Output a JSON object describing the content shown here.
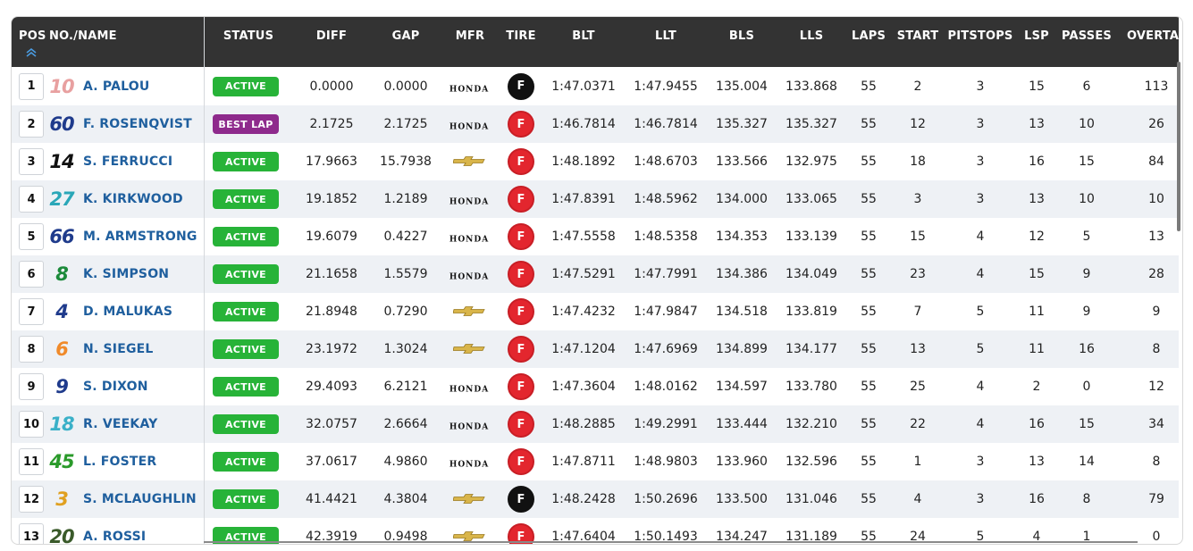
{
  "columns": {
    "pos": "POS",
    "name": "NO./NAME",
    "status": "STATUS",
    "diff": "DIFF",
    "gap": "GAP",
    "mfr": "MFR",
    "tire": "TIRE",
    "blt": "BLT",
    "llt": "LLT",
    "bls": "BLS",
    "lls": "LLS",
    "laps": "LAPS",
    "start": "START",
    "pitstops": "PITSTOPS",
    "lsp": "LSP",
    "passes": "PASSES",
    "overtakes": "OVERTAKE"
  },
  "colors": {
    "active": "#27b338",
    "best_lap": "#8e2a8c",
    "tire_red": "#e3262e",
    "tire_black": "#111111",
    "name_blue": "#1f5f9e",
    "header_bg": "#333333"
  },
  "rows": [
    {
      "pos": "1",
      "num": "10",
      "num_color": "#e8a0a0",
      "name": "A. PALOU",
      "status": "ACTIVE",
      "diff": "0.0000",
      "gap": "0.0000",
      "mfr": "HONDA",
      "tire": "black",
      "blt": "1:47.0371",
      "llt": "1:47.9455",
      "bls": "135.004",
      "lls": "133.868",
      "laps": "55",
      "start": "2",
      "pitstops": "3",
      "lsp": "15",
      "passes": "6",
      "overtakes": "113"
    },
    {
      "pos": "2",
      "num": "60",
      "num_color": "#1f3b8c",
      "name": "F. ROSENQVIST",
      "status": "BEST LAP",
      "diff": "2.1725",
      "gap": "2.1725",
      "mfr": "HONDA",
      "tire": "red",
      "blt": "1:46.7814",
      "llt": "1:46.7814",
      "bls": "135.327",
      "lls": "135.327",
      "laps": "55",
      "start": "12",
      "pitstops": "3",
      "lsp": "13",
      "passes": "10",
      "overtakes": "26"
    },
    {
      "pos": "3",
      "num": "14",
      "num_color": "#111111",
      "name": "S. FERRUCCI",
      "status": "ACTIVE",
      "diff": "17.9663",
      "gap": "15.7938",
      "mfr": "CHEVROLET",
      "tire": "red",
      "blt": "1:48.1892",
      "llt": "1:48.6703",
      "bls": "133.566",
      "lls": "132.975",
      "laps": "55",
      "start": "18",
      "pitstops": "3",
      "lsp": "16",
      "passes": "15",
      "overtakes": "84"
    },
    {
      "pos": "4",
      "num": "27",
      "num_color": "#2aa7b8",
      "name": "K. KIRKWOOD",
      "status": "ACTIVE",
      "diff": "19.1852",
      "gap": "1.2189",
      "mfr": "HONDA",
      "tire": "red",
      "blt": "1:47.8391",
      "llt": "1:48.5962",
      "bls": "134.000",
      "lls": "133.065",
      "laps": "55",
      "start": "3",
      "pitstops": "3",
      "lsp": "13",
      "passes": "10",
      "overtakes": "10"
    },
    {
      "pos": "5",
      "num": "66",
      "num_color": "#1f3b8c",
      "name": "M. ARMSTRONG",
      "status": "ACTIVE",
      "diff": "19.6079",
      "gap": "0.4227",
      "mfr": "HONDA",
      "tire": "red",
      "blt": "1:47.5558",
      "llt": "1:48.5358",
      "bls": "134.353",
      "lls": "133.139",
      "laps": "55",
      "start": "15",
      "pitstops": "4",
      "lsp": "12",
      "passes": "5",
      "overtakes": "13"
    },
    {
      "pos": "6",
      "num": "8",
      "num_color": "#1b8a3a",
      "name": "K. SIMPSON",
      "status": "ACTIVE",
      "diff": "21.1658",
      "gap": "1.5579",
      "mfr": "HONDA",
      "tire": "red",
      "blt": "1:47.5291",
      "llt": "1:47.7991",
      "bls": "134.386",
      "lls": "134.049",
      "laps": "55",
      "start": "23",
      "pitstops": "4",
      "lsp": "15",
      "passes": "9",
      "overtakes": "28"
    },
    {
      "pos": "7",
      "num": "4",
      "num_color": "#1f3b8c",
      "name": "D. MALUKAS",
      "status": "ACTIVE",
      "diff": "21.8948",
      "gap": "0.7290",
      "mfr": "CHEVROLET",
      "tire": "red",
      "blt": "1:47.4232",
      "llt": "1:47.9847",
      "bls": "134.518",
      "lls": "133.819",
      "laps": "55",
      "start": "7",
      "pitstops": "5",
      "lsp": "11",
      "passes": "9",
      "overtakes": "9"
    },
    {
      "pos": "8",
      "num": "6",
      "num_color": "#f08a2a",
      "name": "N. SIEGEL",
      "status": "ACTIVE",
      "diff": "23.1972",
      "gap": "1.3024",
      "mfr": "CHEVROLET",
      "tire": "red",
      "blt": "1:47.1204",
      "llt": "1:47.6969",
      "bls": "134.899",
      "lls": "134.177",
      "laps": "55",
      "start": "13",
      "pitstops": "5",
      "lsp": "11",
      "passes": "16",
      "overtakes": "8"
    },
    {
      "pos": "9",
      "num": "9",
      "num_color": "#1f3b8c",
      "name": "S. DIXON",
      "status": "ACTIVE",
      "diff": "29.4093",
      "gap": "6.2121",
      "mfr": "HONDA",
      "tire": "red",
      "blt": "1:47.3604",
      "llt": "1:48.0162",
      "bls": "134.597",
      "lls": "133.780",
      "laps": "55",
      "start": "25",
      "pitstops": "4",
      "lsp": "2",
      "passes": "0",
      "overtakes": "12"
    },
    {
      "pos": "10",
      "num": "18",
      "num_color": "#3ab0c8",
      "name": "R. VEEKAY",
      "status": "ACTIVE",
      "diff": "32.0757",
      "gap": "2.6664",
      "mfr": "HONDA",
      "tire": "red",
      "blt": "1:48.2885",
      "llt": "1:49.2991",
      "bls": "133.444",
      "lls": "132.210",
      "laps": "55",
      "start": "22",
      "pitstops": "4",
      "lsp": "16",
      "passes": "15",
      "overtakes": "34"
    },
    {
      "pos": "11",
      "num": "45",
      "num_color": "#2a9a2a",
      "name": "L. FOSTER",
      "status": "ACTIVE",
      "diff": "37.0617",
      "gap": "4.9860",
      "mfr": "HONDA",
      "tire": "red",
      "blt": "1:47.8711",
      "llt": "1:48.9803",
      "bls": "133.960",
      "lls": "132.596",
      "laps": "55",
      "start": "1",
      "pitstops": "3",
      "lsp": "13",
      "passes": "14",
      "overtakes": "8"
    },
    {
      "pos": "12",
      "num": "3",
      "num_color": "#e0a020",
      "name": "S. MCLAUGHLIN",
      "status": "ACTIVE",
      "diff": "41.4421",
      "gap": "4.3804",
      "mfr": "CHEVROLET",
      "tire": "black",
      "blt": "1:48.2428",
      "llt": "1:50.2696",
      "bls": "133.500",
      "lls": "131.046",
      "laps": "55",
      "start": "4",
      "pitstops": "3",
      "lsp": "16",
      "passes": "8",
      "overtakes": "79"
    },
    {
      "pos": "13",
      "num": "20",
      "num_color": "#3a5a2a",
      "name": "A. ROSSI",
      "status": "ACTIVE",
      "diff": "42.3919",
      "gap": "0.9498",
      "mfr": "CHEVROLET",
      "tire": "red",
      "blt": "1:47.6404",
      "llt": "1:50.1493",
      "bls": "134.247",
      "lls": "131.189",
      "laps": "55",
      "start": "24",
      "pitstops": "5",
      "lsp": "4",
      "passes": "1",
      "overtakes": "0"
    }
  ]
}
